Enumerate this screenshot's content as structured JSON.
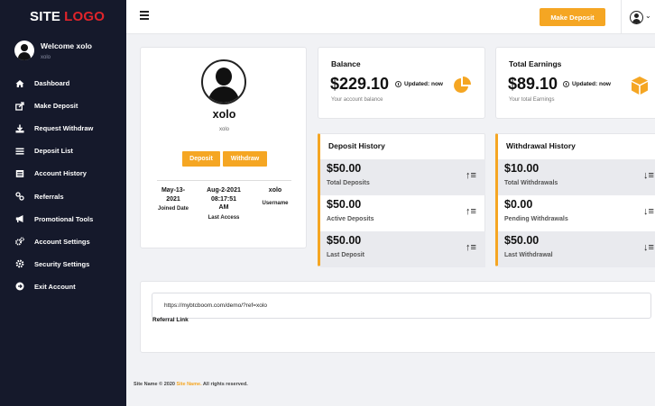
{
  "logo": {
    "part1": "SITE",
    "part2": "LOGO"
  },
  "user": {
    "welcome": "Welcome xolo",
    "username": "xolo"
  },
  "nav": [
    {
      "label": "Dashboard",
      "icon": "home-icon"
    },
    {
      "label": "Make Deposit",
      "icon": "share-icon"
    },
    {
      "label": "Request Withdraw",
      "icon": "download-icon"
    },
    {
      "label": "Deposit List",
      "icon": "list-icon"
    },
    {
      "label": "Account History",
      "icon": "history-icon"
    },
    {
      "label": "Referrals",
      "icon": "users-icon"
    },
    {
      "label": "Promotional Tools",
      "icon": "megaphone-icon"
    },
    {
      "label": "Account Settings",
      "icon": "cogs-icon"
    },
    {
      "label": "Security Settings",
      "icon": "gear-icon"
    },
    {
      "label": "Exit Account",
      "icon": "exit-icon"
    }
  ],
  "topbar": {
    "make_deposit": "Make Deposit"
  },
  "profile": {
    "name": "xolo",
    "sub": "xolo",
    "deposit_btn": "Deposit",
    "withdraw_btn": "Withdraw",
    "joined": {
      "value1": "May-13-",
      "value2": "2021",
      "label": "Joined Date"
    },
    "last_access": {
      "value1": "Aug-2-2021",
      "value2": "08:17:51",
      "value3": "AM",
      "label": "Last Access"
    },
    "username": {
      "value": "xolo",
      "label": "Username"
    }
  },
  "balance": {
    "title": "Balance",
    "amount": "$229.10",
    "updated": "Updated: now",
    "desc": "Your account balance"
  },
  "earnings": {
    "title": "Total Earnings",
    "amount": "$89.10",
    "updated": "Updated: now",
    "desc": "Your total Earnings"
  },
  "deposit_history": {
    "title": "Deposit History",
    "rows": [
      {
        "value": "$50.00",
        "label": "Total Deposits"
      },
      {
        "value": "$50.00",
        "label": "Active Deposits"
      },
      {
        "value": "$50.00",
        "label": "Last Deposit"
      }
    ]
  },
  "withdrawal_history": {
    "title": "Withdrawal History",
    "rows": [
      {
        "value": "$10.00",
        "label": "Total Withdrawals"
      },
      {
        "value": "$0.00",
        "label": "Pending Withdrawals"
      },
      {
        "value": "$50.00",
        "label": "Last Withdrawal"
      }
    ]
  },
  "referral": {
    "link": "https://mybtcboom.com/demo/?ref=xolo",
    "label": "Referral Link"
  },
  "footer": {
    "pre": "Site Name © 2020 ",
    "accent": "Site Name.",
    "post": " All rights reserved."
  },
  "colors": {
    "accent": "#f5a623",
    "sidebar": "#15192b",
    "logo_red": "#e0242b"
  }
}
